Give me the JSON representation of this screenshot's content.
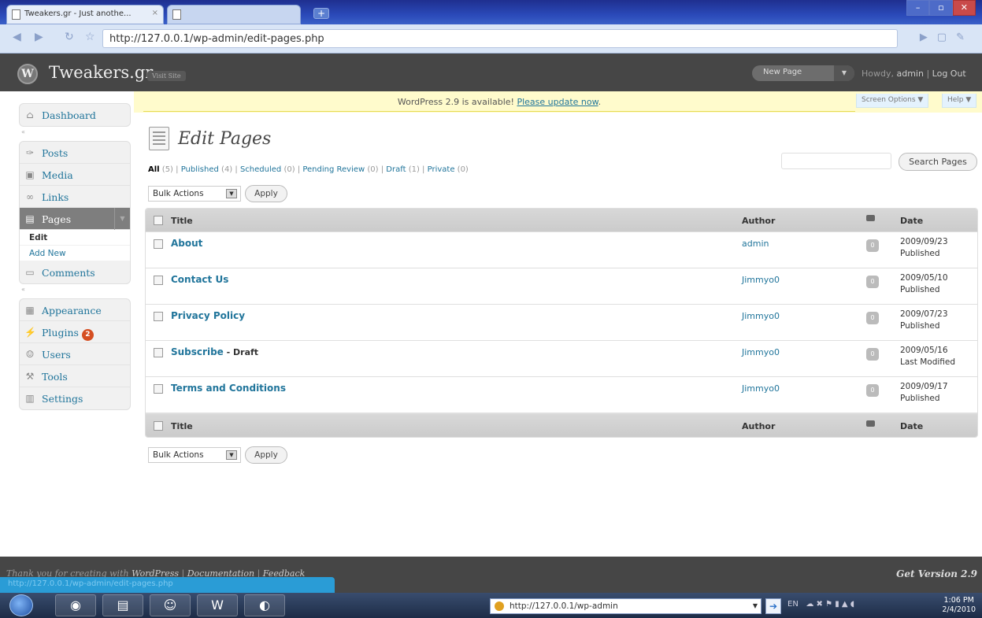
{
  "browser": {
    "tabs": [
      {
        "title": "Tweakers.gr - Just anothe...",
        "close": "×"
      },
      {
        "title": "",
        "close": ""
      }
    ],
    "new_tab": "+",
    "window_controls": [
      "–",
      "▫",
      "✕"
    ],
    "url": "http://127.0.0.1/wp-admin/edit-pages.php",
    "status_url": "http://127.0.0.1/wp-admin/edit-pages.php"
  },
  "header": {
    "logo": "W",
    "site_title": "Tweakers.gr",
    "visit_site": "Visit Site",
    "new_page": "New Page",
    "new_page_arrow": "▼",
    "howdy_prefix": "Howdy, ",
    "user": "admin",
    "separator": " | ",
    "logout": "Log Out"
  },
  "nag": {
    "text": "WordPress 2.9 is available! ",
    "link": "Please update now",
    "end": "."
  },
  "screen_meta": {
    "screen_options": "Screen Options ▼",
    "help": "Help ▼"
  },
  "sidebar": {
    "dashboard": "Dashboard",
    "posts": "Posts",
    "media": "Media",
    "links": "Links",
    "pages": "Pages",
    "pages_sub": [
      "Edit",
      "Add New"
    ],
    "comments": "Comments",
    "appearance": "Appearance",
    "plugins": "Plugins",
    "plugins_badge": "2",
    "users": "Users",
    "tools": "Tools",
    "settings": "Settings"
  },
  "main": {
    "title": "Edit Pages",
    "filters": [
      {
        "label": "All",
        "count": "(5)"
      },
      {
        "label": "Published",
        "count": "(4)"
      },
      {
        "label": "Scheduled",
        "count": "(0)"
      },
      {
        "label": "Pending Review",
        "count": "(0)"
      },
      {
        "label": "Draft",
        "count": "(1)"
      },
      {
        "label": "Private",
        "count": "(0)"
      }
    ],
    "search_button": "Search Pages",
    "bulk_actions": "Bulk Actions",
    "apply": "Apply",
    "columns": {
      "title": "Title",
      "author": "Author",
      "date": "Date"
    },
    "rows": [
      {
        "title": "About",
        "state": "",
        "author": "admin",
        "comments": "0",
        "date": "2009/09/23",
        "status": "Published"
      },
      {
        "title": "Contact Us",
        "state": "",
        "author": "Jimmyo0",
        "comments": "0",
        "date": "2009/05/10",
        "status": "Published"
      },
      {
        "title": "Privacy Policy",
        "state": "",
        "author": "Jimmyo0",
        "comments": "0",
        "date": "2009/07/23",
        "status": "Published"
      },
      {
        "title": "Subscribe",
        "state": " - Draft",
        "author": "Jimmyo0",
        "comments": "0",
        "date": "2009/05/16",
        "status": "Last Modified"
      },
      {
        "title": "Terms and Conditions",
        "state": "",
        "author": "Jimmyo0",
        "comments": "0",
        "date": "2009/09/17",
        "status": "Published"
      }
    ]
  },
  "footer": {
    "thanks": "Thank you for creating with ",
    "wordpress": "WordPress",
    "sep": " | ",
    "documentation": "Documentation",
    "feedback": "Feedback",
    "version": "Get Version 2.9"
  },
  "taskbar": {
    "address": "http://127.0.0.1/wp-admin",
    "lang": "EN",
    "time": "1:06 PM",
    "date": "2/4/2010"
  }
}
